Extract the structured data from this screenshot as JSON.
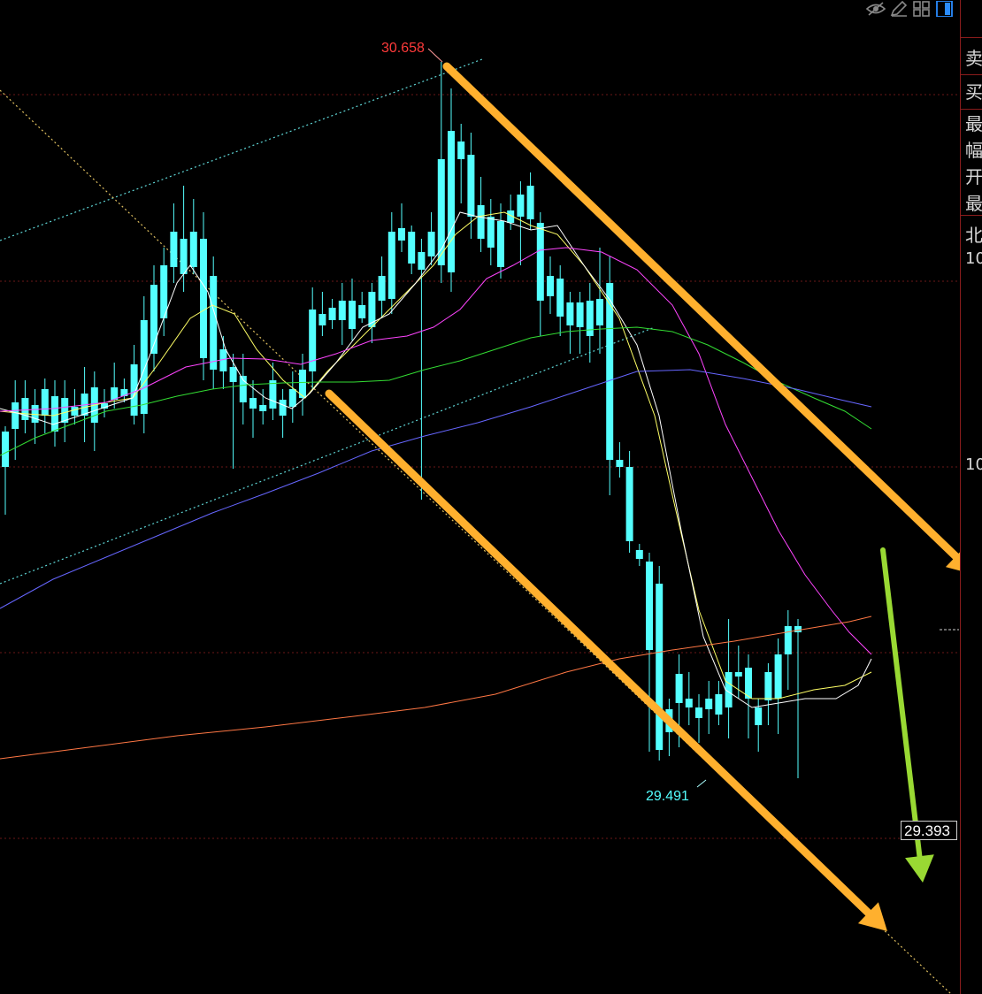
{
  "chart_data": {
    "type": "candlestick",
    "title": "",
    "xlabel": "",
    "ylabel": "",
    "ylim": [
      29.3,
      30.7
    ],
    "grid": true,
    "high_label": "30.658",
    "low_label": "29.491",
    "last_price_label": "29.393",
    "series_colors": {
      "up_candle": "#e03030",
      "down_candle": "#54ffff",
      "ma5": "#ffffff",
      "ma10": "#ffff66",
      "ma20": "#ff44ff",
      "ma30": "#33dd33",
      "ma60": "#6666ff",
      "ma120": "#ff7744"
    },
    "annotation_colors": {
      "channel_arrows": "#ffb02e",
      "target_arrow": "#99d933",
      "channel_dotted": "#5fd7d7",
      "diagonal_dotted": "#e0c060"
    }
  },
  "sidebar": {
    "labels": [
      "卖",
      "买",
      "最",
      "幅",
      "开",
      "最",
      "北"
    ],
    "numbers": [
      "10",
      "10"
    ]
  },
  "toolbar": {
    "icons": [
      "eye-off-icon",
      "pencil-icon",
      "grid-icon",
      "panel-icon"
    ]
  }
}
